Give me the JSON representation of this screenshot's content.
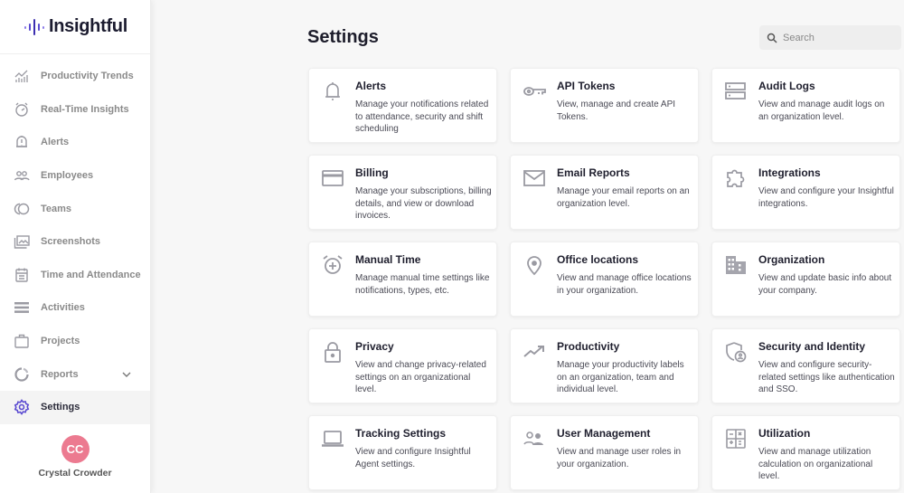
{
  "app": {
    "brand": "Insightful"
  },
  "sidebar": {
    "items": [
      {
        "label": "Productivity Trends",
        "icon": "chart-trend-icon",
        "active": false
      },
      {
        "label": "Real-Time Insights",
        "icon": "stopwatch-icon",
        "active": false
      },
      {
        "label": "Alerts",
        "icon": "bell-alert-icon",
        "active": false
      },
      {
        "label": "Employees",
        "icon": "employees-icon",
        "active": false
      },
      {
        "label": "Teams",
        "icon": "teams-icon",
        "active": false
      },
      {
        "label": "Screenshots",
        "icon": "screenshots-icon",
        "active": false
      },
      {
        "label": "Time and Attendance",
        "icon": "calendar-icon",
        "active": false
      },
      {
        "label": "Activities",
        "icon": "activities-icon",
        "active": false
      },
      {
        "label": "Projects",
        "icon": "briefcase-icon",
        "active": false
      },
      {
        "label": "Reports",
        "icon": "reports-icon",
        "active": false,
        "expandable": true
      },
      {
        "label": "Settings",
        "icon": "gear-icon",
        "active": true
      }
    ],
    "user": {
      "initials": "CC",
      "name": "Crystal Crowder",
      "avatar_color": "#ec7a90"
    }
  },
  "header": {
    "title": "Settings",
    "search": {
      "placeholder": "Search",
      "value": ""
    }
  },
  "cards": [
    {
      "title": "Alerts",
      "description": "Manage your notifications related to attendance, security and shift scheduling",
      "icon": "bell-icon"
    },
    {
      "title": "API Tokens",
      "description": "View, manage and create API Tokens.",
      "icon": "key-icon"
    },
    {
      "title": "Audit Logs",
      "description": "View and manage audit logs on an organization level.",
      "icon": "server-icon"
    },
    {
      "title": "Billing",
      "description": "Manage your subscriptions, billing details, and view or download invoices.",
      "icon": "credit-card-icon"
    },
    {
      "title": "Email Reports",
      "description": "Manage your email reports on an organization level.",
      "icon": "envelope-icon"
    },
    {
      "title": "Integrations",
      "description": "View and configure your Insightful integrations.",
      "icon": "puzzle-icon"
    },
    {
      "title": "Manual Time",
      "description": "Manage manual time settings like notifications, types, etc.",
      "icon": "alarm-plus-icon"
    },
    {
      "title": "Office locations",
      "description": "View and manage office locations in your organization.",
      "icon": "location-pin-icon"
    },
    {
      "title": "Organization",
      "description": "View and update basic info about your company.",
      "icon": "building-icon"
    },
    {
      "title": "Privacy",
      "description": "View and change privacy-related settings on an organizational level.",
      "icon": "lock-icon"
    },
    {
      "title": "Productivity",
      "description": "Manage your productivity labels on an organization, team and individual level.",
      "icon": "trending-up-icon"
    },
    {
      "title": "Security and Identity",
      "description": "View and configure security-related settings like authentication and SSO.",
      "icon": "shield-user-icon"
    },
    {
      "title": "Tracking Settings",
      "description": "View and configure Insightful Agent settings.",
      "icon": "laptop-icon"
    },
    {
      "title": "User Management",
      "description": "View and manage user roles in your organization.",
      "icon": "users-icon"
    },
    {
      "title": "Utilization",
      "description": "View and manage utilization calculation on organizational level.",
      "icon": "calculator-icon"
    }
  ],
  "colors": {
    "brand_purple": "#5b4bd1",
    "icon_gray": "#9a9aa2",
    "active_icon": "#5b4bd1"
  }
}
